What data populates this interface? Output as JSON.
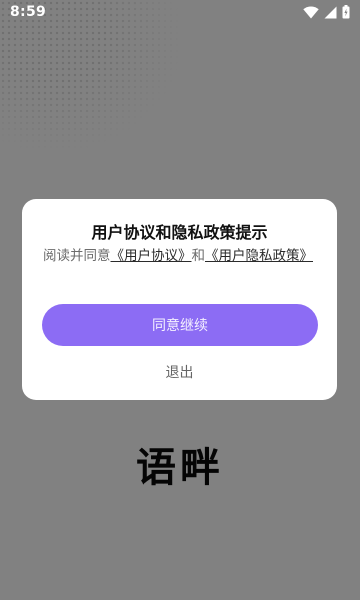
{
  "status_bar": {
    "time": "8:59",
    "icons": [
      "wifi-icon",
      "cell-signal-icon",
      "battery-icon"
    ]
  },
  "dialog": {
    "title": "用户协议和隐私政策提示",
    "message": {
      "prefix": "阅读并同意",
      "link1": "《用户协议》",
      "middle": "和",
      "link2": "《用户隐私政策》"
    },
    "agree_label": "同意继续",
    "exit_label": "退出"
  },
  "app_name": "语畔",
  "colors": {
    "backdrop": "#818181",
    "accent": "#8c6cf4",
    "dialog_bg": "#ffffff"
  }
}
